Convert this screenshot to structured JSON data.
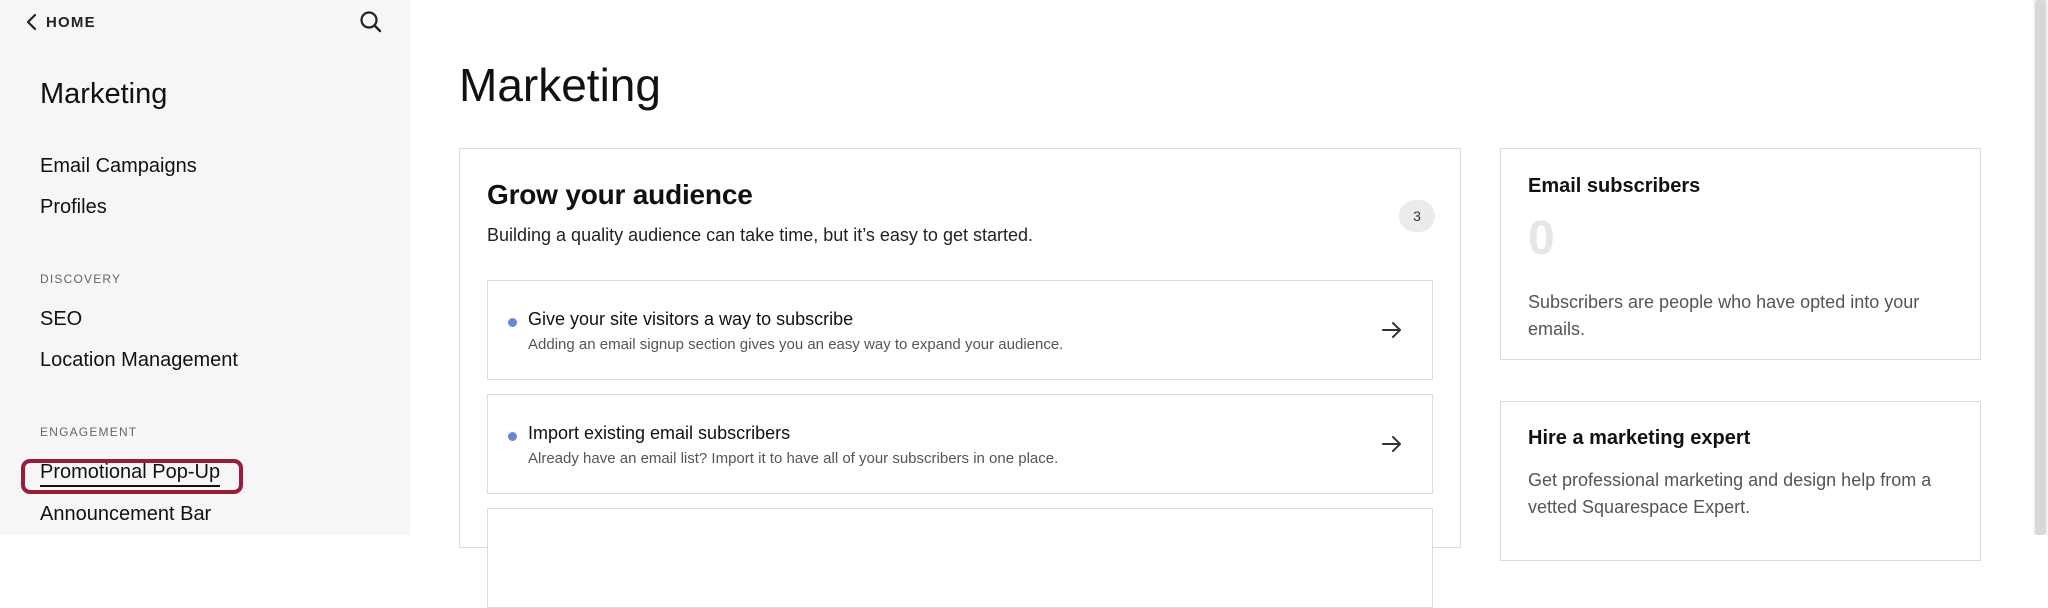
{
  "sidebar": {
    "home_label": "HOME",
    "title": "Marketing",
    "items": [
      {
        "label": "Email Campaigns"
      },
      {
        "label": "Profiles"
      }
    ],
    "sections": [
      {
        "label": "DISCOVERY",
        "items": [
          {
            "label": "SEO"
          },
          {
            "label": "Location Management"
          }
        ]
      },
      {
        "label": "ENGAGEMENT",
        "items": [
          {
            "label": "Promotional Pop-Up"
          },
          {
            "label": "Announcement Bar"
          }
        ]
      }
    ],
    "active_item": "Promotional Pop-Up"
  },
  "main": {
    "title": "Marketing",
    "grow_card": {
      "title": "Grow your audience",
      "subtitle": "Building a quality audience can take time, but it’s easy to get started.",
      "count": "3",
      "tasks": [
        {
          "title": "Give your site visitors a way to subscribe",
          "description": "Adding an email signup section gives you an easy way to expand your audience."
        },
        {
          "title": "Import existing email subscribers",
          "description": "Already have an email list? Import it to have all of your subscribers in one place."
        }
      ]
    },
    "subscribers_card": {
      "title": "Email subscribers",
      "value": "0",
      "body": "Subscribers are people who have opted into your emails."
    },
    "expert_card": {
      "title": "Hire a marketing expert",
      "body": "Get professional marketing and design help from a vetted Squarespace Expert."
    }
  },
  "colors": {
    "sidebar_bg": "#f6f6f6",
    "highlight": "#9b1b3a",
    "task_dot": "#6b86d6"
  },
  "icons": [
    "chevron-left-icon",
    "search-icon",
    "arrow-right-icon"
  ]
}
